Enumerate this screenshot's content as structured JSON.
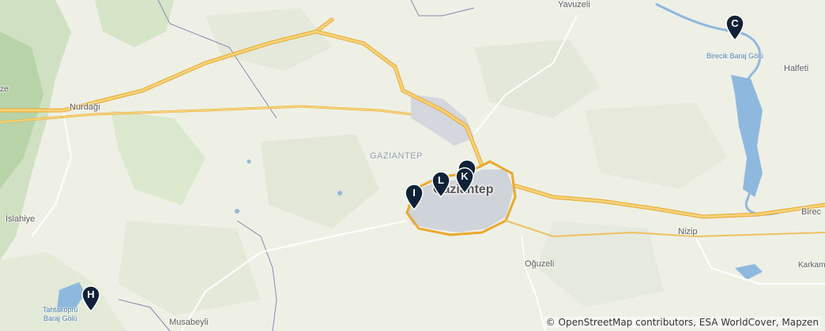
{
  "map": {
    "places": [
      {
        "name": "Yavuzeli"
      },
      {
        "name": "Halfeti"
      },
      {
        "name": "Nurdağı"
      },
      {
        "name": "İslahiye"
      },
      {
        "name": "Nizip"
      },
      {
        "name": "Oğuzeli"
      },
      {
        "name": "Musabeyli"
      },
      {
        "name": "Karkamı"
      },
      {
        "name": "Birec"
      },
      {
        "name": "ze"
      }
    ],
    "region_label": "GAZIANTEP",
    "city_label": "Gaziantep",
    "water_labels": [
      {
        "line1": "Birecik Baraj Gölü",
        "line2": ""
      },
      {
        "line1": "Tahtaköprü",
        "line2": "Baraj Gölü"
      }
    ],
    "markers": [
      {
        "label": "C"
      },
      {
        "label": "H"
      },
      {
        "label": "I"
      },
      {
        "label": "L"
      },
      {
        "label": "K"
      },
      {
        "label": ""
      }
    ],
    "attribution": "© OpenStreetMap contributors, ESA WorldCover, Mapzen",
    "colors": {
      "marker": "#0f2238",
      "motorway": "#f2c14e",
      "water": "#8fb8de",
      "urban": "#cfd3da",
      "border": "#8a86b0"
    }
  }
}
